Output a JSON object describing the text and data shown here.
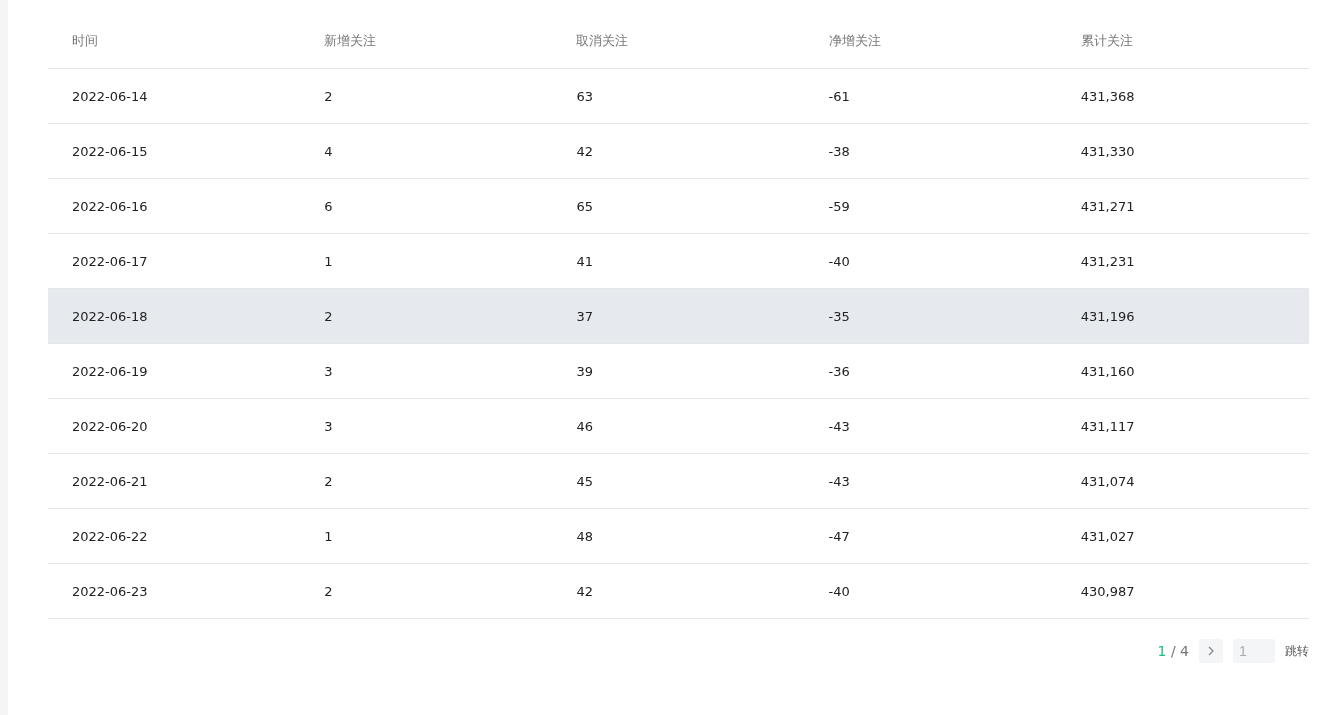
{
  "table": {
    "columns": [
      "时间",
      "新增关注",
      "取消关注",
      "净增关注",
      "累计关注"
    ],
    "rows": [
      {
        "cells": [
          "2022-06-14",
          "2",
          "63",
          "-61",
          "431,368"
        ],
        "selected": false
      },
      {
        "cells": [
          "2022-06-15",
          "4",
          "42",
          "-38",
          "431,330"
        ],
        "selected": false
      },
      {
        "cells": [
          "2022-06-16",
          "6",
          "65",
          "-59",
          "431,271"
        ],
        "selected": false
      },
      {
        "cells": [
          "2022-06-17",
          "1",
          "41",
          "-40",
          "431,231"
        ],
        "selected": false
      },
      {
        "cells": [
          "2022-06-18",
          "2",
          "37",
          "-35",
          "431,196"
        ],
        "selected": true
      },
      {
        "cells": [
          "2022-06-19",
          "3",
          "39",
          "-36",
          "431,160"
        ],
        "selected": false
      },
      {
        "cells": [
          "2022-06-20",
          "3",
          "46",
          "-43",
          "431,117"
        ],
        "selected": false
      },
      {
        "cells": [
          "2022-06-21",
          "2",
          "45",
          "-43",
          "431,074"
        ],
        "selected": false
      },
      {
        "cells": [
          "2022-06-22",
          "1",
          "48",
          "-47",
          "431,027"
        ],
        "selected": false
      },
      {
        "cells": [
          "2022-06-23",
          "2",
          "42",
          "-40",
          "430,987"
        ],
        "selected": false
      }
    ]
  },
  "pagination": {
    "current": "1",
    "separator": "/",
    "total": "4",
    "jump_value": "1",
    "jump_label": "跳转"
  }
}
